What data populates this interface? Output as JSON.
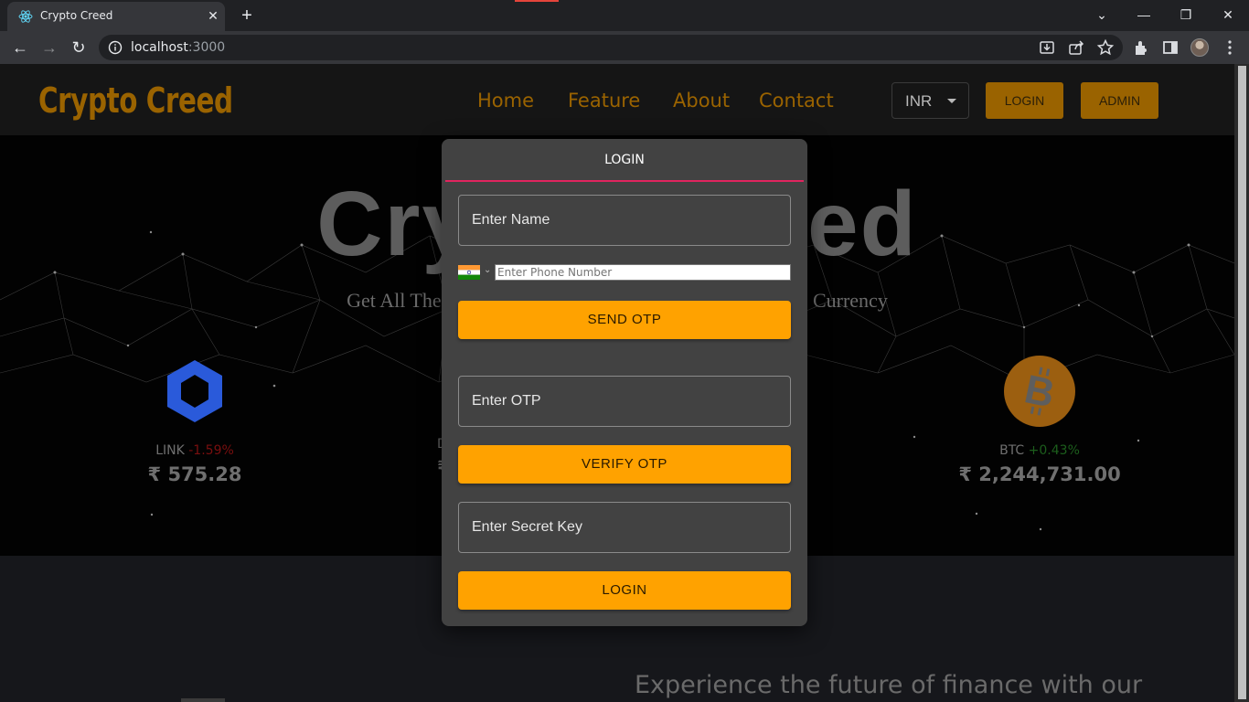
{
  "browser": {
    "tab_title": "Crypto Creed",
    "url_host": "localhost",
    "url_port": ":3000"
  },
  "navbar": {
    "brand": "Crypto Creed",
    "links": [
      "Home",
      "Feature",
      "About",
      "Contact"
    ],
    "currency": "INR",
    "login_label": "LOGIN",
    "admin_label": "ADMIN"
  },
  "hero": {
    "title": "Crypto Creed",
    "subtitle": "Get All The Information Regarding Your Favorite Crypto Currency",
    "coins": [
      {
        "symbol": "LINK",
        "change": "-1.59%",
        "direction": "down",
        "price": "₹ 575.28"
      },
      {
        "symbol": "BTC",
        "change": "+0.43%",
        "direction": "up",
        "price": "₹ 2,244,731.00"
      }
    ],
    "partial_coin_symbol_initial": "D",
    "partial_coin_price_initial": "₹"
  },
  "section": {
    "heading": "Experience the future of finance with our"
  },
  "modal": {
    "tab_label": "LOGIN",
    "name_placeholder": "Enter Name",
    "phone_placeholder": "Enter Phone Number",
    "send_otp_label": "SEND OTP",
    "otp_placeholder": "Enter OTP",
    "verify_otp_label": "VERIFY OTP",
    "secret_key_placeholder": "Enter Secret Key",
    "login_label": "LOGIN"
  },
  "colors": {
    "brand_gold": "#9a6300",
    "button_orange": "#ffa200",
    "tab_indicator": "#e0245e",
    "negative": "#7a0f0f",
    "positive": "#1c5e1c"
  }
}
